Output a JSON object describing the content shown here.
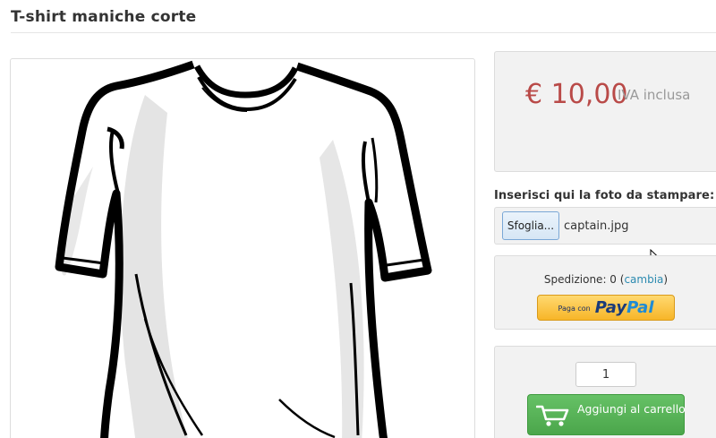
{
  "page": {
    "title": "T-shirt maniche corte"
  },
  "product": {
    "image_alt": "T-shirt maniche corte",
    "icon": "tshirt-image"
  },
  "price": {
    "amount": "€ 10,00",
    "vat_note": "IVA inclusa",
    "color": "#b94a48"
  },
  "upload": {
    "label": "Inserisci qui la foto da stampare:",
    "browse_label": "Sfoglia...",
    "file_name": "captain.jpg"
  },
  "shipping": {
    "prefix": "Spedizione: 0 (",
    "change_link": "cambia",
    "suffix": ")",
    "paypal_prefix": "Paga con",
    "paypal_pay": "Pay",
    "paypal_pal": "Pal"
  },
  "cart": {
    "quantity": "1",
    "add_label": "Aggiungi al carrello",
    "button_color": "#5cb85c"
  },
  "icons": {
    "cart": "shopping-cart-icon",
    "cursor": "mouse-cursor-icon"
  }
}
